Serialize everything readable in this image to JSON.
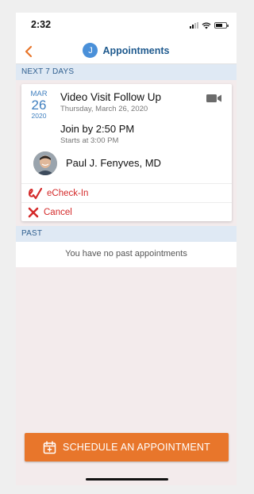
{
  "status_bar": {
    "time": "2:32"
  },
  "nav": {
    "title": "Appointments",
    "avatar_initial": "J"
  },
  "sections": {
    "upcoming": "NEXT 7 DAYS",
    "past": "PAST"
  },
  "appointment": {
    "month": "MAR",
    "day": "26",
    "year": "2020",
    "title": "Video Visit Follow Up",
    "date_text": "Thursday, March 26, 2020",
    "join_text": "Join by 2:50 PM",
    "start_text": "Starts at 3:00 PM",
    "provider": "Paul J. Fenyves, MD"
  },
  "actions": {
    "echeckin": "eCheck-In",
    "cancel": "Cancel"
  },
  "past": {
    "empty_text": "You have no past appointments"
  },
  "schedule_button": {
    "label": "SCHEDULE AN APPOINTMENT"
  },
  "colors": {
    "accent": "#e8762b",
    "link": "#1f5a8e",
    "danger": "#d42a2a",
    "date": "#3f7fbf"
  }
}
